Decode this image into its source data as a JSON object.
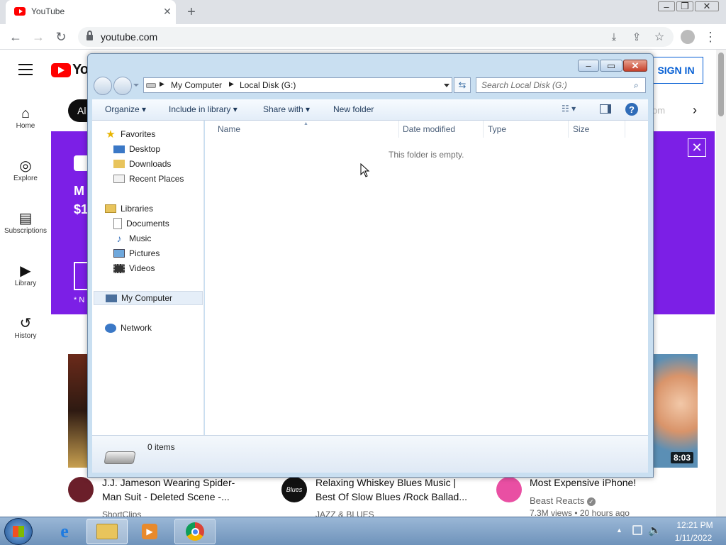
{
  "browser": {
    "tab_title": "YouTube",
    "url": "youtube.com",
    "icons": [
      "youtube-favicon",
      "close-icon",
      "plus-icon",
      "back-icon",
      "forward-icon",
      "reload-icon",
      "lock-icon",
      "install-icon",
      "share-icon",
      "star-icon",
      "profile-icon",
      "menu-dots-icon"
    ]
  },
  "youtube": {
    "nav": [
      {
        "label": "Home",
        "icon": "home-icon"
      },
      {
        "label": "Explore",
        "icon": "compass-icon"
      },
      {
        "label": "Subscriptions",
        "icon": "subscriptions-icon"
      },
      {
        "label": "Library",
        "icon": "library-icon"
      },
      {
        "label": "History",
        "icon": "history-icon"
      }
    ],
    "sign_in": "SIGN IN",
    "chip_partial": "Al",
    "chip_partial_right": "om",
    "banner_partial_1": "M",
    "banner_partial_2": "$1",
    "banner_note": "* N",
    "videos": [
      {
        "title_line1": "J.J. Jameson Wearing Spider-",
        "title_line2": "Man Suit - Deleted Scene -...",
        "channel": "ShortClips"
      },
      {
        "title_line1": "Relaxing Whiskey Blues Music |",
        "title_line2": "Best Of Slow Blues /Rock Ballad...",
        "channel": "JAZZ & BLUES",
        "avatar_text": "Blues"
      },
      {
        "title_line1": "Most Expensive iPhone!",
        "channel": "Beast Reacts",
        "stats": "7.3M views • 20 hours ago",
        "duration": "8:03"
      }
    ]
  },
  "explorer": {
    "breadcrumb": [
      "My Computer",
      "Local Disk (G:)"
    ],
    "search_placeholder": "Search Local Disk (G:)",
    "toolbar": {
      "organize": "Organize",
      "include": "Include in library",
      "share": "Share with",
      "new_folder": "New folder"
    },
    "nav": {
      "favorites": "Favorites",
      "fav_items": [
        "Desktop",
        "Downloads",
        "Recent Places"
      ],
      "libraries": "Libraries",
      "lib_items": [
        "Documents",
        "Music",
        "Pictures",
        "Videos"
      ],
      "computer": "My Computer",
      "network": "Network"
    },
    "columns": [
      "Name",
      "Date modified",
      "Type",
      "Size"
    ],
    "empty_message": "This folder is empty.",
    "item_count": "0 items"
  },
  "taskbar": {
    "time": "12:21 PM",
    "date": "1/11/2022"
  }
}
